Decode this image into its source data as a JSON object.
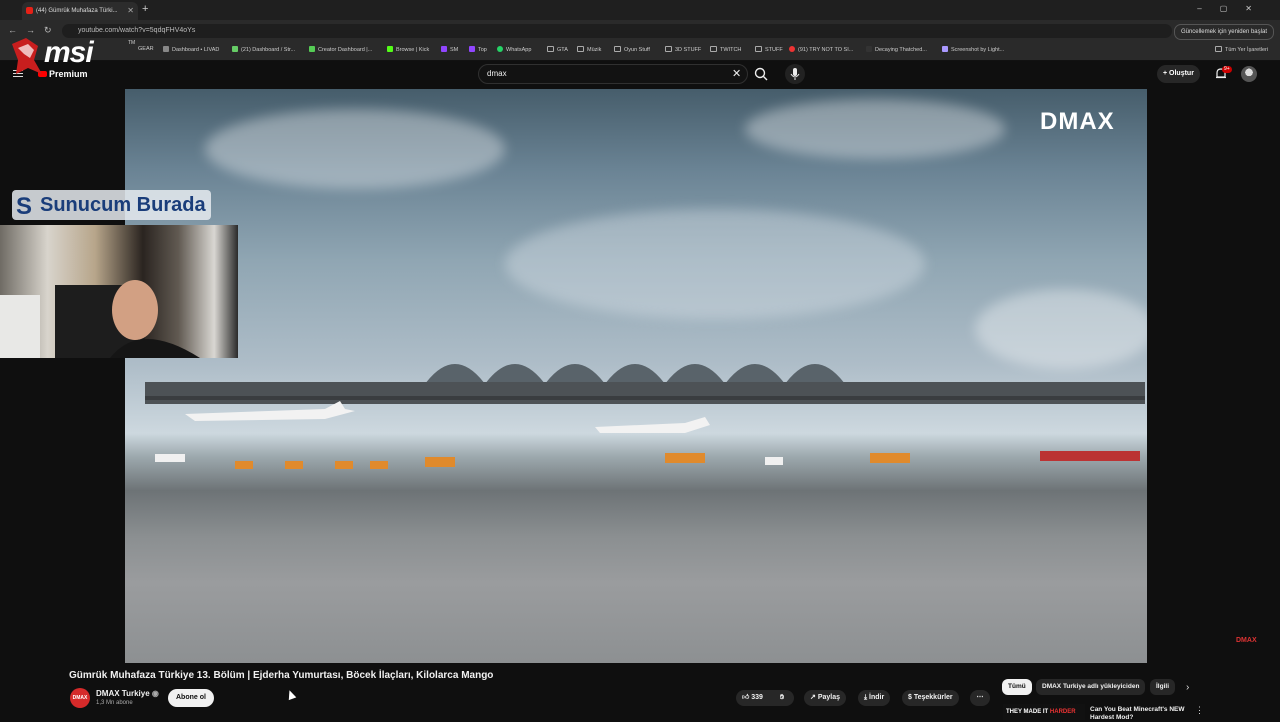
{
  "browser": {
    "tab_title": "(44) Gümrük Muhafaza Türki...",
    "url": "youtube.com/watch?v=5qdqFHV4oYs",
    "update_button": "Güncellemek için yeniden başlat",
    "bookmarks": [
      "GEAR",
      "Dashboard • LIVAD",
      "(21) Dashboard / Str...",
      "Creator Dashboard |...",
      "Browse | Kick",
      "SM",
      "Top",
      "WhatsApp",
      "GTA",
      "Müzik",
      "Oyun Stuff",
      "3D STUFF",
      "TWITCH",
      "STUFF",
      "(91) TRY NOT TO SI...",
      "Decaying Thatched...",
      "Screenshot by Light..."
    ],
    "all_bookmarks": "Tüm Yer İşaretleri"
  },
  "overlay": {
    "msi": "msi",
    "msi_tm": "TM",
    "sunucum": "Sunucum Burada",
    "sunucum_mark": "S"
  },
  "youtube": {
    "premium_label": "Premium",
    "search_value": "dmax",
    "create_label": "Oluştur",
    "notif_badge": "9+"
  },
  "video": {
    "watermark": "DMAX",
    "corner_logo": "DMAX"
  },
  "meta": {
    "title": "Gümrük Muhafaza Türkiye 13. Bölüm | Ejderha Yumurtası, Böcek İlaçları, Kilolarca Mango",
    "channel_avatar": "DMAX",
    "channel_name": "DMAX Turkiye",
    "subscribers": "1,3 Mn abone",
    "subscribe_label": "Abone ol",
    "likes": "339",
    "share_label": "Paylaş",
    "download_label": "İndir",
    "thanks_label": "Teşekkürler"
  },
  "sidebar": {
    "chips": [
      "Tümü",
      "DMAX Turkiye adlı yükleyiciden",
      "İlgili"
    ],
    "rec_thumb_text": "THEY MADE IT",
    "rec_thumb_highlight": "HARDER",
    "rec_title": "Can You Beat Minecraft's NEW Hardest Mod?"
  },
  "colors": {
    "accent": "#ff0000",
    "background": "#0f0f0f",
    "pill": "#272727"
  }
}
